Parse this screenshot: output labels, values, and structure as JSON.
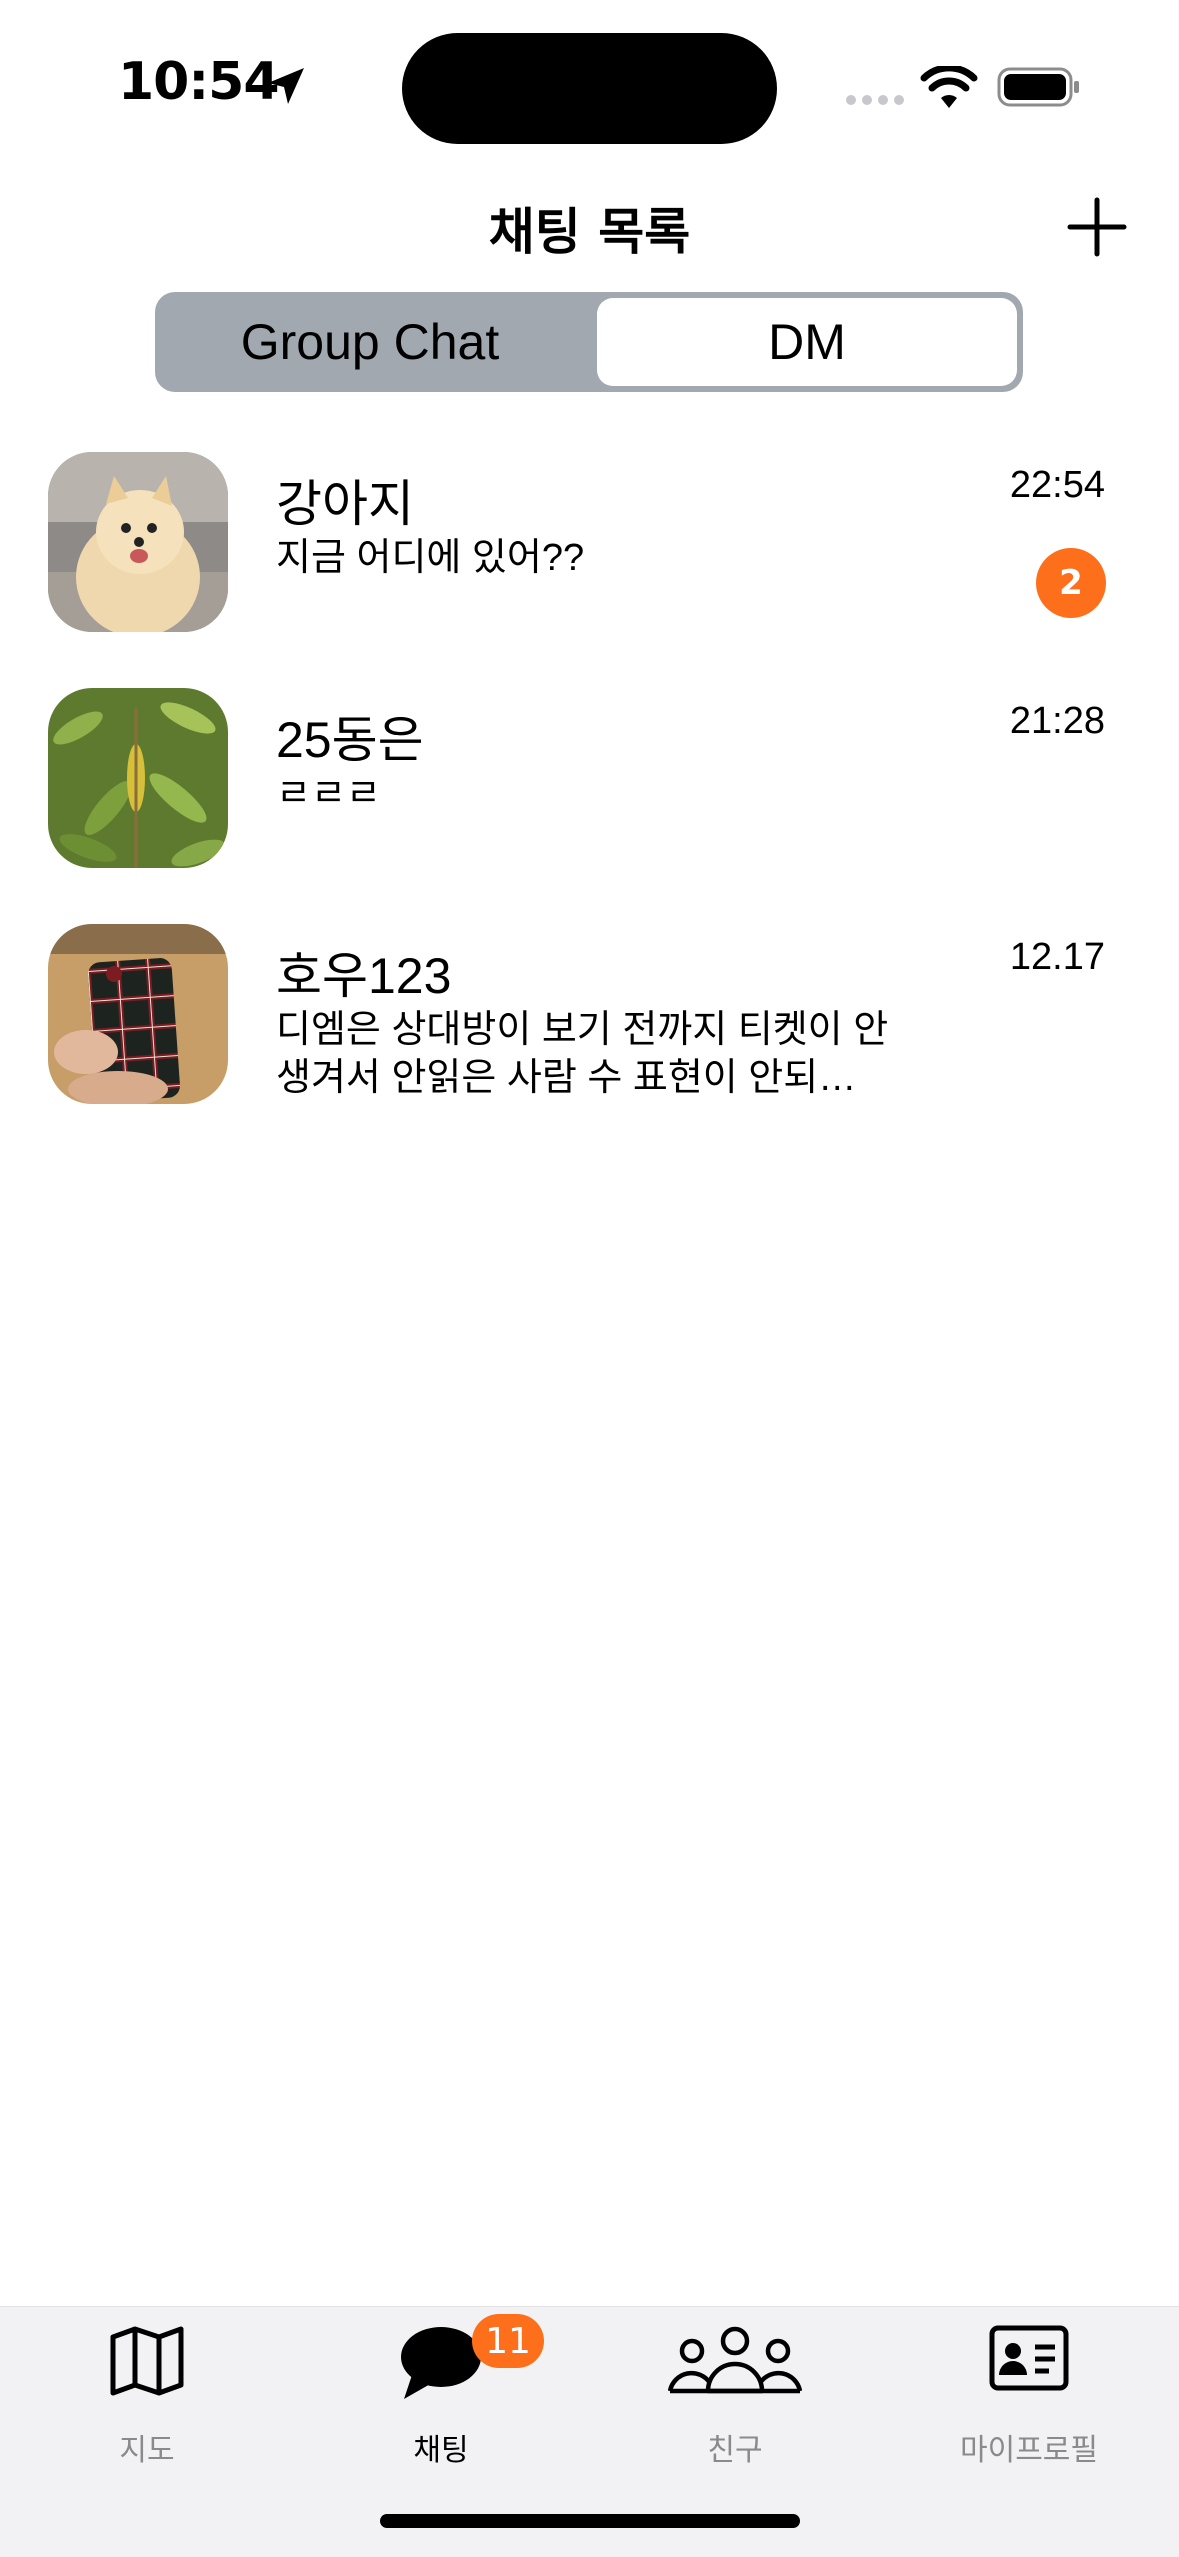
{
  "status_bar": {
    "time": "10:54"
  },
  "header": {
    "title": "채팅 목록"
  },
  "segments": {
    "group_chat": "Group Chat",
    "dm": "DM",
    "selected": "DM"
  },
  "chats": [
    {
      "name": "강아지",
      "message": "지금 어디에 있어??",
      "time": "22:54",
      "unread": "2"
    },
    {
      "name": "25동은",
      "message": "ㄹㄹㄹ",
      "time": "21:28",
      "unread": ""
    },
    {
      "name": "호우123",
      "message": "디엠은 상대방이 보기 전까지 티켓이 안생겨서 안읽은 사람 수 표현이 안되…",
      "time": "12.17",
      "unread": ""
    }
  ],
  "tabbar": {
    "items": [
      {
        "label": "지도",
        "icon": "map-icon"
      },
      {
        "label": "채팅",
        "icon": "chat-bubble-icon"
      },
      {
        "label": "친구",
        "icon": "friends-icon"
      },
      {
        "label": "마이프로필",
        "icon": "profile-card-icon"
      }
    ],
    "chat_badge": "11",
    "active": "채팅"
  },
  "colors": {
    "accent": "#fe6f1c",
    "segment_bg": "#a2a8b0",
    "tabbar_bg": "#f2f2f4"
  }
}
